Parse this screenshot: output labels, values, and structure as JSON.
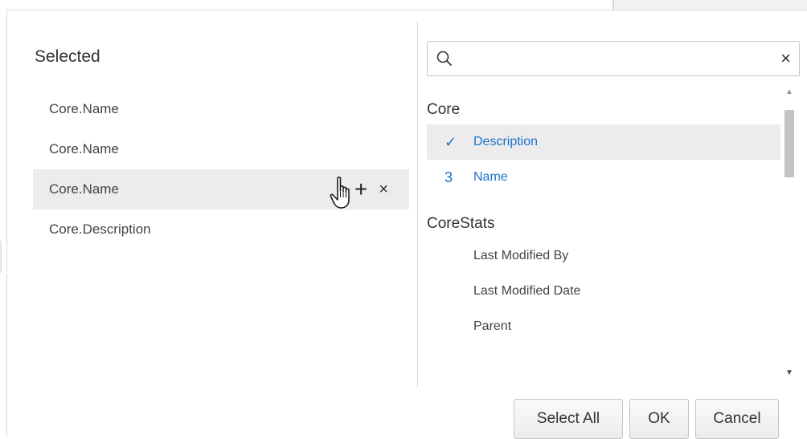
{
  "selected_panel": {
    "title": "Selected",
    "items": [
      {
        "label": "Core.Name"
      },
      {
        "label": "Core.Name"
      },
      {
        "label": "Core.Name"
      },
      {
        "label": "Core.Description"
      }
    ],
    "hover_actions": {
      "add": "+",
      "remove": "×"
    }
  },
  "available_panel": {
    "search": {
      "value": "",
      "placeholder": "",
      "clear": "×"
    },
    "groups": [
      {
        "name": "Core",
        "items": [
          {
            "label": "Description",
            "mark": "✓",
            "state": "selected"
          },
          {
            "label": "Name",
            "mark": "3",
            "state": "linked"
          }
        ]
      },
      {
        "name": "CoreStats",
        "items": [
          {
            "label": "Last Modified By"
          },
          {
            "label": "Last Modified Date"
          },
          {
            "label": "Parent"
          }
        ]
      }
    ]
  },
  "buttons": {
    "select_all": "Select All",
    "ok": "OK",
    "cancel": "Cancel"
  },
  "colors": {
    "accent": "#1a73c8",
    "hover_row": "#ececec"
  }
}
